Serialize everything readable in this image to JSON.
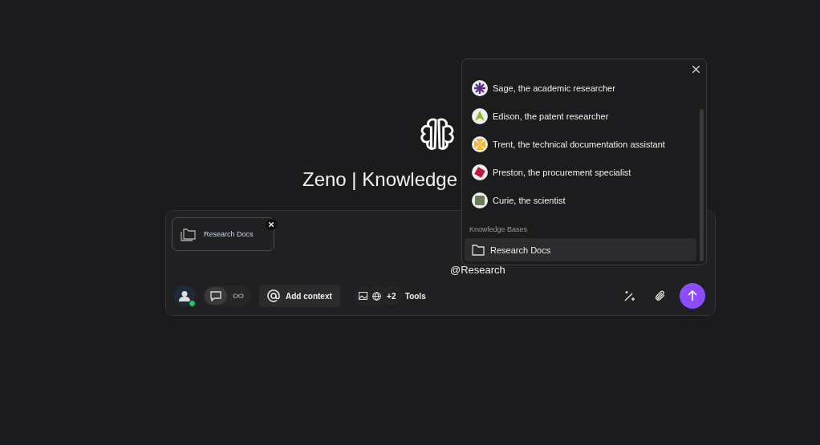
{
  "title": "Zeno | Knowledge",
  "composer": {
    "attachment": {
      "label": "Research Docs"
    },
    "value": "@Research",
    "mode_buttons": [
      {
        "kind": "chat",
        "selected": true
      },
      {
        "kind": "loop",
        "selected": false
      }
    ],
    "add_context": "Add context",
    "tools_extra": "+2",
    "tools_label": "Tools",
    "user_online": true
  },
  "mention_menu": {
    "agents": [
      {
        "name": "Sage, the academic researcher",
        "color": "#5b2a86",
        "kind": "asterisk"
      },
      {
        "name": "Edison, the patent researcher",
        "color": "#8fb81e",
        "kind": "triangle"
      },
      {
        "name": "Trent, the technical documentation assistant",
        "color": "#f5b82e",
        "kind": "pinwheel"
      },
      {
        "name": "Preston, the procurement specialist",
        "color": "#c0173f",
        "kind": "diamond"
      },
      {
        "name": "Curie, the scientist",
        "color": "#6b7d5c",
        "kind": "square"
      }
    ],
    "section_label": "Knowledge Bases",
    "knowledge_bases": [
      {
        "name": "Research Docs",
        "selected": true
      }
    ]
  }
}
